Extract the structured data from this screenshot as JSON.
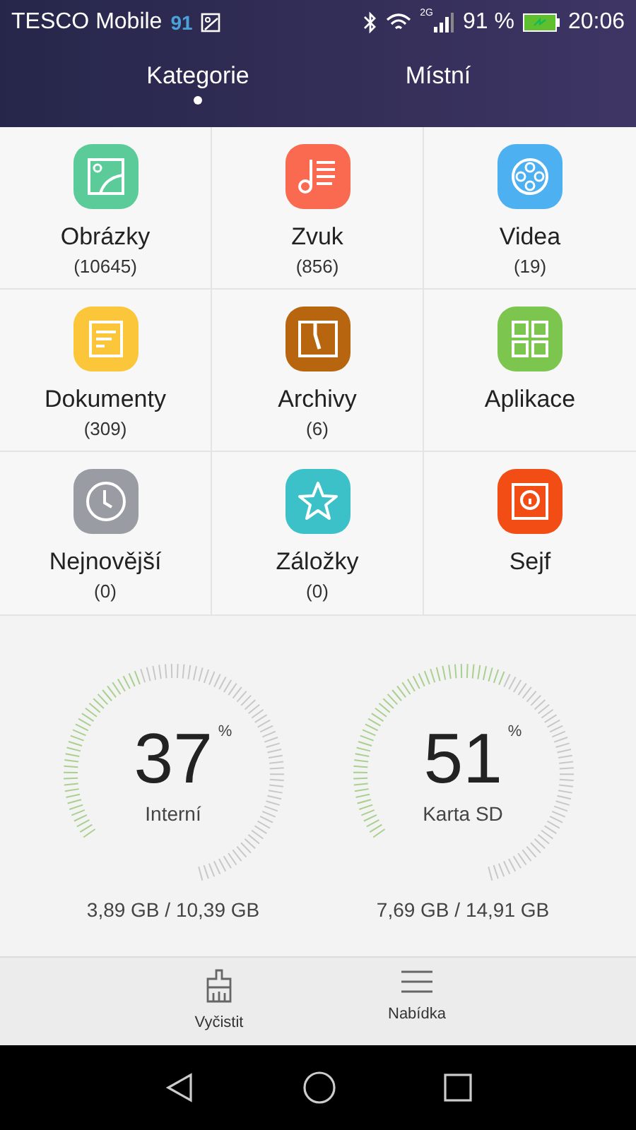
{
  "status_bar": {
    "carrier": "TESCO Mobile",
    "badge": "91",
    "network": "2G",
    "battery": "91 %",
    "time": "20:06"
  },
  "tabs": [
    {
      "label": "Kategorie",
      "selected": true
    },
    {
      "label": "Místní",
      "selected": false
    }
  ],
  "categories": [
    {
      "kind": "image",
      "color": "#5ccb9a",
      "label": "Obrázky",
      "count": "(10645)"
    },
    {
      "kind": "music",
      "color": "#f96a50",
      "label": "Zvuk",
      "count": "(856)"
    },
    {
      "kind": "video",
      "color": "#4db0f0",
      "label": "Videa",
      "count": "(19)"
    },
    {
      "kind": "document",
      "color": "#fbc63a",
      "label": "Dokumenty",
      "count": "(309)"
    },
    {
      "kind": "archive",
      "color": "#b8650f",
      "label": "Archivy",
      "count": "(6)"
    },
    {
      "kind": "apps",
      "color": "#7cc54f",
      "label": "Aplikace"
    },
    {
      "kind": "clock",
      "color": "#9a9ca3",
      "label": "Nejnovější",
      "count": "(0)"
    },
    {
      "kind": "star",
      "color": "#3cc1c9",
      "label": "Záložky",
      "count": "(0)"
    },
    {
      "kind": "safe",
      "color": "#f14d14",
      "label": "Sejf"
    }
  ],
  "storage": [
    {
      "percent": "37",
      "unit": "%",
      "name": "Interní",
      "usage": "3,89 GB / 10,39 GB"
    },
    {
      "percent": "51",
      "unit": "%",
      "name": "Karta SD",
      "usage": "7,69 GB / 14,91 GB"
    }
  ],
  "actions": [
    {
      "kind": "clean",
      "label": "Vyčistit"
    },
    {
      "kind": "menu",
      "label": "Nabídka"
    }
  ]
}
